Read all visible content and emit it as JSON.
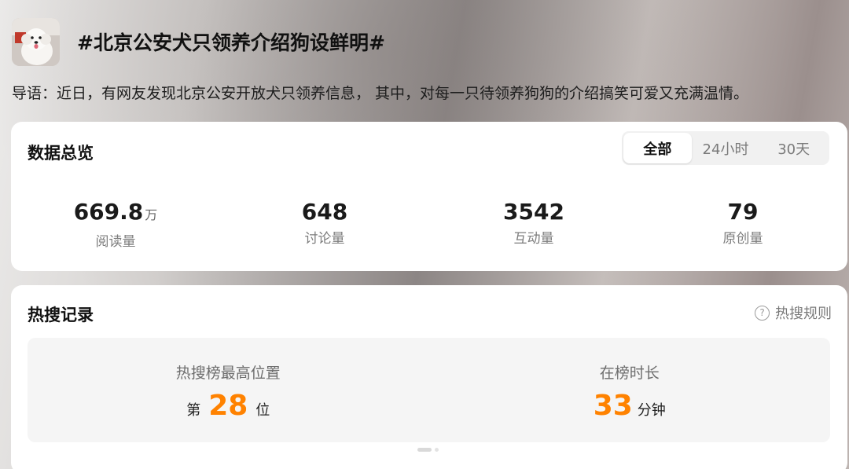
{
  "topic": {
    "title": "#北京公安犬只领养介绍狗设鲜明#",
    "intro": "导语：近日，有网友发现北京公安开放犬只领养信息， 其中，对每一只待领养狗狗的介绍搞笑可爱又充满温情。"
  },
  "overview": {
    "title": "数据总览",
    "tabs": [
      {
        "label": "全部",
        "active": true
      },
      {
        "label": "24小时",
        "active": false
      },
      {
        "label": "30天",
        "active": false
      }
    ],
    "stats": [
      {
        "value": "669.8",
        "unit": "万",
        "label": "阅读量"
      },
      {
        "value": "648",
        "unit": "",
        "label": "讨论量"
      },
      {
        "value": "3542",
        "unit": "",
        "label": "互动量"
      },
      {
        "value": "79",
        "unit": "",
        "label": "原创量"
      }
    ]
  },
  "hot": {
    "title": "热搜记录",
    "rules_label": "热搜规则",
    "rules_icon": "question-circle-icon",
    "peak": {
      "label": "热搜榜最高位置",
      "prefix": "第",
      "value": "28",
      "suffix": "位"
    },
    "duration": {
      "label": "在榜时长",
      "value": "33",
      "suffix": "分钟"
    },
    "accent_color": "#ff8200"
  }
}
